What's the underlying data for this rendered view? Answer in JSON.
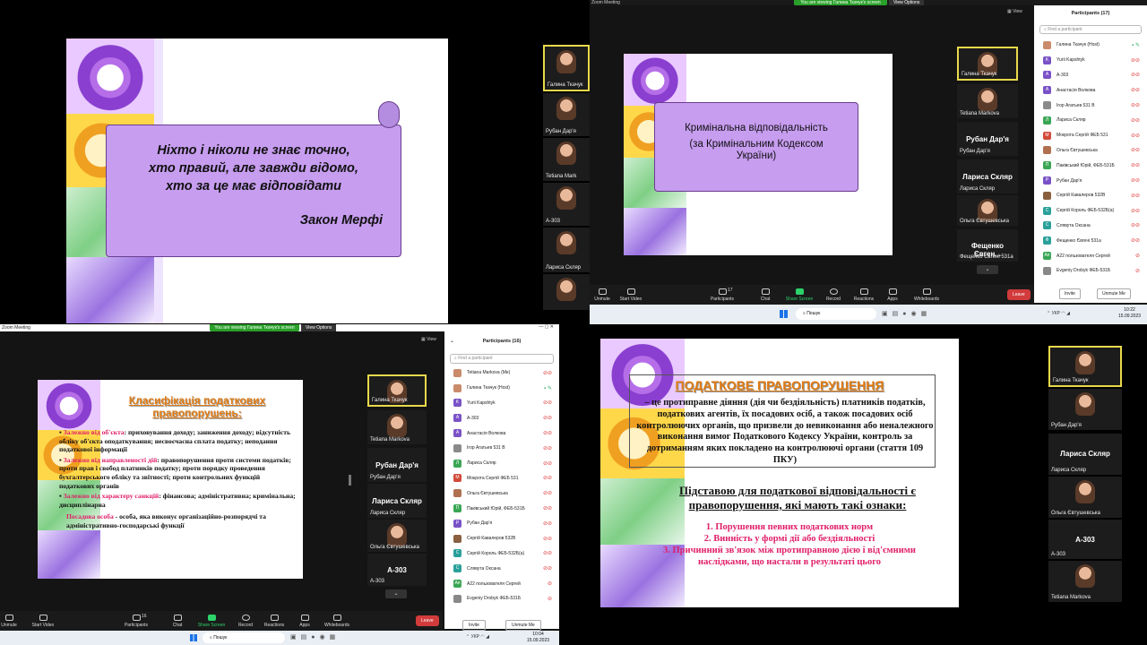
{
  "q1": {
    "slide_lines": [
      "Ніхто і ніколи не знає точно,",
      "хто правий, але завжди відомо,",
      "хто за це має відповідати"
    ],
    "author": "Закон Мерфі",
    "tiles": [
      {
        "name": "Галина Ткачук"
      },
      {
        "name": "Рубан Дар'я"
      },
      {
        "name": "Tetiana Mark"
      },
      {
        "name": "А-303"
      },
      {
        "name": "Лариса Скляр"
      },
      {
        "name": ""
      }
    ]
  },
  "q2": {
    "app_title": "Zoom Meeting",
    "banner": "You are viewing Галина Ткачук's screen",
    "view_options": "View Options",
    "view_label": "View",
    "slide_title": "Кримінальна відповідальність",
    "slide_sub": "(за Кримінальним Кодексом України)",
    "tiles": [
      {
        "name": "Галина Ткачук"
      },
      {
        "name": "Tetiana Markova"
      },
      {
        "name": "Рубан Дар'я",
        "big": "Рубан Дар'я"
      },
      {
        "name": "Лариса Скляр",
        "big": "Лариса Скляр"
      },
      {
        "name": "Ольга Євтушевська"
      },
      {
        "name": "Фещенко Євгені 531а",
        "big": "Фещенко Євген..."
      }
    ],
    "toolbar": {
      "unmute": "Unmute",
      "start_video": "Start Video",
      "participants": "Participants",
      "participants_count": "17",
      "chat": "Chat",
      "share": "Share Screen",
      "record": "Record",
      "reactions": "Reactions",
      "apps": "Apps",
      "whiteboards": "Whiteboards",
      "leave": "Leave"
    },
    "panel": {
      "title": "Participants (17)",
      "search_placeholder": "Find a participant",
      "participants": [
        {
          "name": "Галина Ткачук (Host)",
          "initial": "",
          "color": "#c98b6b"
        },
        {
          "name": "Yurii Kapshtyk",
          "initial": "K",
          "color": "#7a52c7"
        },
        {
          "name": "А-303",
          "initial": "А",
          "color": "#7a52c7"
        },
        {
          "name": "Анастасія Волкова",
          "initial": "А",
          "color": "#7a52c7"
        },
        {
          "name": "Ігор Агатьев 531 В",
          "initial": "",
          "color": "#8a8a8a"
        },
        {
          "name": "Лариса Скляр",
          "initial": "Л",
          "color": "#3aa655"
        },
        {
          "name": "Мокрота Сергій ФЕБ 531",
          "initial": "М",
          "color": "#d24a3a"
        },
        {
          "name": "Ольга Євтушевська",
          "initial": "",
          "color": "#b07050"
        },
        {
          "name": "Паківський Юрій, ФЕБ-531Б",
          "initial": "П",
          "color": "#3aa655"
        },
        {
          "name": "Рубан Дар'я",
          "initial": "Р",
          "color": "#7a52c7"
        },
        {
          "name": "Сергій Кавалеров 532В",
          "initial": "",
          "color": "#8a6040"
        },
        {
          "name": "Сергій Король ФЕБ-532Б(а)",
          "initial": "С",
          "color": "#2aa09a"
        },
        {
          "name": "Слявута Оксана",
          "initial": "С",
          "color": "#2aa09a"
        },
        {
          "name": "Фещенко Євгені 531а",
          "initial": "Ф",
          "color": "#2aa09a"
        },
        {
          "name": "A22 пользователя Сергей",
          "initial": "Ап",
          "color": "#3aa655"
        },
        {
          "name": "Evgeniy Drobyk ФЕБ-531Б",
          "initial": "",
          "color": "#888"
        }
      ],
      "invite": "Invite",
      "mute_me": "Unmute Me"
    },
    "taskbar": {
      "search": "Пошук",
      "lang": "УКР",
      "time": "10:22",
      "date": "15.09.2023"
    }
  },
  "q3": {
    "app_title": "Zoom Meeting",
    "banner": "You are viewing Галина Ткачук's screen",
    "view_options": "View Options",
    "view_label": "View",
    "slide_title_1": "Класифікація податкових",
    "slide_title_2": "правопорушень:",
    "items": [
      {
        "label": "Залежно від об'єкта",
        "text": ": приховування доходу; заниження доходу; відсутність обліку об'єкта оподаткування; несвоєчасна сплата податку; неподання податкової інформації"
      },
      {
        "label": "Залежно від направленості дій",
        "text": ": правопорушення проти системи податків; проти прав і свобод платників податку; проти порядку проведення бухгалтерського обліку та звітності; проти контрольних функцій податкових органів"
      },
      {
        "label": "Залежно від характеру санкцій",
        "text": ": фінансова; адміністративна; кримінальна; дисциплінарна"
      },
      {
        "label": "Посадова особа",
        "text": " - особа, яка виконує організаційно-розпорядчі та адміністративно-господарські функції"
      }
    ],
    "tiles": [
      {
        "name": "Галина Ткачук"
      },
      {
        "name": "Tetiana Markova"
      },
      {
        "name": "Рубан Дар'я",
        "big": "Рубан Дар'я"
      },
      {
        "name": "Лариса Скляр",
        "big": "Лариса Скляр"
      },
      {
        "name": "Ольга Євтушевська"
      },
      {
        "name": "А-303",
        "big": "А-303"
      }
    ],
    "toolbar": {
      "unmute": "Unmute",
      "start_video": "Start Video",
      "participants": "Participants",
      "participants_count": "16",
      "chat": "Chat",
      "share": "Share Screen",
      "record": "Record",
      "reactions": "Reactions",
      "apps": "Apps",
      "whiteboards": "Whiteboards",
      "leave": "Leave"
    },
    "panel": {
      "title": "Participants (16)",
      "search_placeholder": "Find a participant",
      "participants": [
        {
          "name": "Tetiana Markova (Me)",
          "initial": "",
          "color": "#c98b6b"
        },
        {
          "name": "Галина Ткачук (Host)",
          "initial": "",
          "color": "#c98b6b"
        },
        {
          "name": "Yurii Kapshtyk",
          "initial": "K",
          "color": "#7a52c7"
        },
        {
          "name": "А-303",
          "initial": "А",
          "color": "#7a52c7"
        },
        {
          "name": "Анастасія Волкова",
          "initial": "А",
          "color": "#7a52c7"
        },
        {
          "name": "Ігор Агатьев 531 В",
          "initial": "",
          "color": "#8a8a8a"
        },
        {
          "name": "Лариса Скляр",
          "initial": "Л",
          "color": "#3aa655"
        },
        {
          "name": "Мокрота Сергій ФЕБ 531",
          "initial": "М",
          "color": "#d24a3a"
        },
        {
          "name": "Ольга Євтушевська",
          "initial": "",
          "color": "#b07050"
        },
        {
          "name": "Паківський Юрій, ФЕБ-531Б",
          "initial": "П",
          "color": "#3aa655"
        },
        {
          "name": "Рубан Дар'я",
          "initial": "Р",
          "color": "#7a52c7"
        },
        {
          "name": "Сергій Кавалеров 532В",
          "initial": "",
          "color": "#8a6040"
        },
        {
          "name": "Сергій Король ФЕБ-532Б(а)",
          "initial": "С",
          "color": "#2aa09a"
        },
        {
          "name": "Слявута Оксана",
          "initial": "С",
          "color": "#2aa09a"
        },
        {
          "name": "A22 пользователя Сергей",
          "initial": "Ап",
          "color": "#3aa655"
        },
        {
          "name": "Evgeniy Drobyk ФЕБ-531Б",
          "initial": "",
          "color": "#888"
        }
      ],
      "invite": "Invite",
      "mute_me": "Unmute Me"
    },
    "taskbar": {
      "search": "Пошук",
      "lang": "УКР",
      "time": "10:04",
      "date": "15.09.2023"
    }
  },
  "q4": {
    "title": "ПОДАТКОВЕ ПРАВОПОРУШЕННЯ",
    "definition": "– це протиправне діяння (дія чи бездіяльність) платників податків, податкових агентів, їх посадових осіб, а також посадових осіб контролюючих органів, що призвели до невиконання або неналежного виконання вимог Податкового Кодексу України, контроль за дотриманням яких покладено на контролюючі органи (стаття 109 ПКУ)",
    "subtitle": "Підставою для податкової відповідальності є правопорушення, які мають такі ознаки:",
    "points": [
      "1. Порушення певних податкових норм",
      "2. Винність у формі дії або бездіяльності",
      "3. Причинний зв'язок між протиправною дією і від'ємними наслідками, що настали в результаті цього"
    ],
    "tiles": [
      {
        "name": "Галина Ткачук"
      },
      {
        "name": "Рубан Дар'я"
      },
      {
        "name": "Лариса Скляр",
        "big": "Лариса Скляр"
      },
      {
        "name": "Ольга Євтушевська"
      },
      {
        "name": "А-303",
        "big": "А-303"
      },
      {
        "name": "Tetiana Markova"
      }
    ]
  }
}
